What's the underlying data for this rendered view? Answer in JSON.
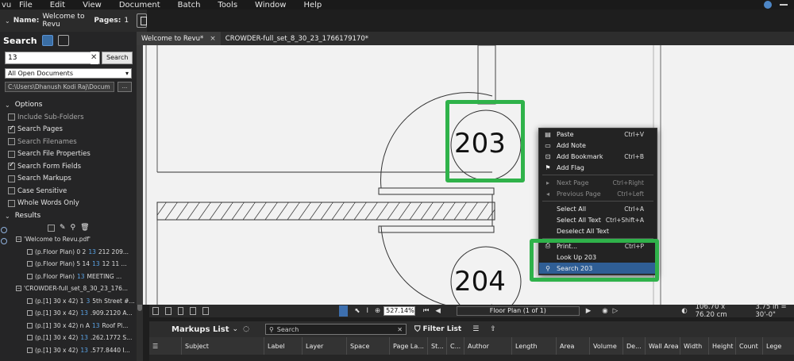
{
  "menubar": {
    "app_fragment": "vu",
    "items": [
      "File",
      "Edit",
      "View",
      "Document",
      "Batch",
      "Tools",
      "Window",
      "Help"
    ]
  },
  "namebar": {
    "name_label": "Name:",
    "name_value": "Welcome to Revu",
    "pages_label": "Pages:",
    "pages_value": "1"
  },
  "search": {
    "title": "Search",
    "query": "13",
    "search_button": "Search",
    "scope": "All Open Documents",
    "path": "C:\\Users\\Dhanush Kodi Raj\\Docum",
    "browse": "...",
    "options_label": "Options",
    "options": [
      {
        "label": "Include Sub-Folders",
        "checked": false,
        "dim": true
      },
      {
        "label": "Search Pages",
        "checked": true,
        "dim": false
      },
      {
        "label": "Search Filenames",
        "checked": false,
        "dim": true
      },
      {
        "label": "Search File Properties",
        "checked": false,
        "dim": false
      },
      {
        "label": "Search Form Fields",
        "checked": true,
        "dim": false
      },
      {
        "label": "Search Markups",
        "checked": false,
        "dim": false
      },
      {
        "label": "Case Sensitive",
        "checked": false,
        "dim": false
      },
      {
        "label": "Whole Words Only",
        "checked": false,
        "dim": false
      }
    ],
    "results_label": "Results",
    "results": [
      {
        "indent": 20,
        "text": "'Welcome to Revu.pdf'",
        "hl": "",
        "rest": ""
      },
      {
        "indent": 34,
        "text": "(p.Floor Plan) 0 2",
        "hl": "13",
        "rest": " 212 209..."
      },
      {
        "indent": 34,
        "text": "(p.Floor Plan) 5 14 ",
        "hl": "13",
        "rest": " 12 11 ..."
      },
      {
        "indent": 34,
        "text": "(p.Floor Plan) ",
        "hl": "13",
        "rest": " MEETING ..."
      },
      {
        "indent": 20,
        "text": "'CROWDER-full_set_8_30_23_176...",
        "hl": "",
        "rest": ""
      },
      {
        "indent": 34,
        "text": "(p.[1] 30 x 42) 1",
        "hl": "3",
        "rest": "5th Street #..."
      },
      {
        "indent": 34,
        "text": "(p.[1] 30 x 42) ",
        "hl": "13",
        "rest": ".909.2120 A..."
      },
      {
        "indent": 34,
        "text": "(p.[1] 30 x 42) n A",
        "hl": "13",
        "rest": " Roof Pl..."
      },
      {
        "indent": 34,
        "text": "(p.[1] 30 x 42) ",
        "hl": "13",
        "rest": ".262.1772 S..."
      },
      {
        "indent": 34,
        "text": "(p.[1] 30 x 42) ",
        "hl": "13",
        "rest": ".577.8440 I..."
      }
    ]
  },
  "tabs": [
    {
      "label": "Welcome to Revu*",
      "active": true,
      "close": "×"
    },
    {
      "label": "CROWDER-full_set_8_30_23_1766179170*",
      "active": false,
      "close": ""
    }
  ],
  "drawing": {
    "room_a": "203",
    "room_b": "204"
  },
  "context_menu": {
    "items": [
      {
        "label": "Paste",
        "shortcut": "Ctrl+V",
        "disabled": false,
        "icon": "paste-icon"
      },
      {
        "label": "Add Note",
        "shortcut": "",
        "disabled": false,
        "icon": "note-icon"
      },
      {
        "label": "Add Bookmark",
        "shortcut": "Ctrl+B",
        "disabled": false,
        "icon": "bookmark-icon"
      },
      {
        "label": "Add Flag",
        "shortcut": "",
        "disabled": false,
        "icon": "flag-icon"
      },
      {
        "sep": true
      },
      {
        "label": "Next Page",
        "shortcut": "Ctrl+Right",
        "disabled": true,
        "icon": "next-icon"
      },
      {
        "label": "Previous Page",
        "shortcut": "Ctrl+Left",
        "disabled": true,
        "icon": "prev-icon"
      },
      {
        "sep": true
      },
      {
        "label": "Select All",
        "shortcut": "Ctrl+A",
        "disabled": false,
        "icon": ""
      },
      {
        "label": "Select All Text",
        "shortcut": "Ctrl+Shift+A",
        "disabled": false,
        "icon": ""
      },
      {
        "label": "Deselect All Text",
        "shortcut": "",
        "disabled": false,
        "icon": ""
      },
      {
        "sep": true
      },
      {
        "label": "Print...",
        "shortcut": "Ctrl+P",
        "disabled": false,
        "icon": "print-icon"
      },
      {
        "label": "Look Up 203",
        "shortcut": "",
        "disabled": false,
        "icon": ""
      },
      {
        "label": "Search 203",
        "shortcut": "",
        "disabled": false,
        "icon": "search-icon",
        "selected": true
      }
    ]
  },
  "statusbar": {
    "zoom": "527.14%",
    "page": "Floor Plan (1 of 1)",
    "size": "106.70 x 76.20 cm",
    "scale": "3.75 in = 30'-0\""
  },
  "markups": {
    "title": "Markups List",
    "search_placeholder": "Search",
    "filter_label": "Filter List",
    "columns": [
      "Subject",
      "Label",
      "Layer",
      "Space",
      "Page La...",
      "St...",
      "C...",
      "Author",
      "Length",
      "Area",
      "Volume",
      "De...",
      "Wall Area",
      "Width",
      "Height",
      "Count",
      "Lege"
    ]
  },
  "colors": {
    "highlight_green": "#2fb24a",
    "accent_blue": "#3d6fae",
    "result_highlight": "#5aa3e6"
  }
}
